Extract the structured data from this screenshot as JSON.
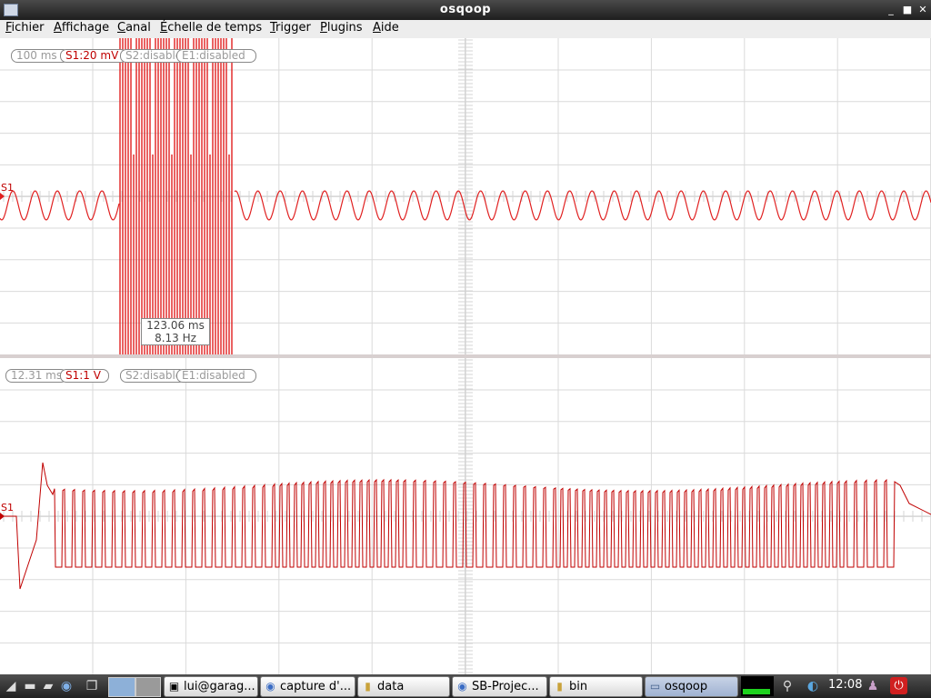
{
  "window": {
    "title": "osqoop"
  },
  "menu": [
    {
      "u": "F",
      "rest": "ichier"
    },
    {
      "u": "A",
      "rest": "ffichage"
    },
    {
      "u": "C",
      "rest": "anal"
    },
    {
      "u": "É",
      "rest": "chelle de temps"
    },
    {
      "u": "T",
      "rest": "rigger"
    },
    {
      "u": "P",
      "rest": "lugins"
    },
    {
      "u": "A",
      "rest": "ide"
    }
  ],
  "scope1": {
    "pills": [
      "100 ms",
      "S1:20 mV",
      "S2:disabled",
      "E1:disabled"
    ],
    "channel_label": "S1",
    "measure": {
      "period": "123.06 ms",
      "frequency": "8.13 Hz"
    }
  },
  "scope2": {
    "pills": [
      "12.31 ms",
      "S1:1 V",
      "S2:disabled",
      "E1:disabled"
    ],
    "channel_label": "S1"
  },
  "colors": {
    "trace_top": "#e02020",
    "trace_bottom": "#c00000",
    "grid": "#dadada"
  },
  "taskbar": {
    "tasks": [
      "lui@garag...",
      "capture d'...",
      "data",
      "SB-Projec...",
      "bin",
      "osqoop"
    ],
    "clock": "12:08"
  }
}
